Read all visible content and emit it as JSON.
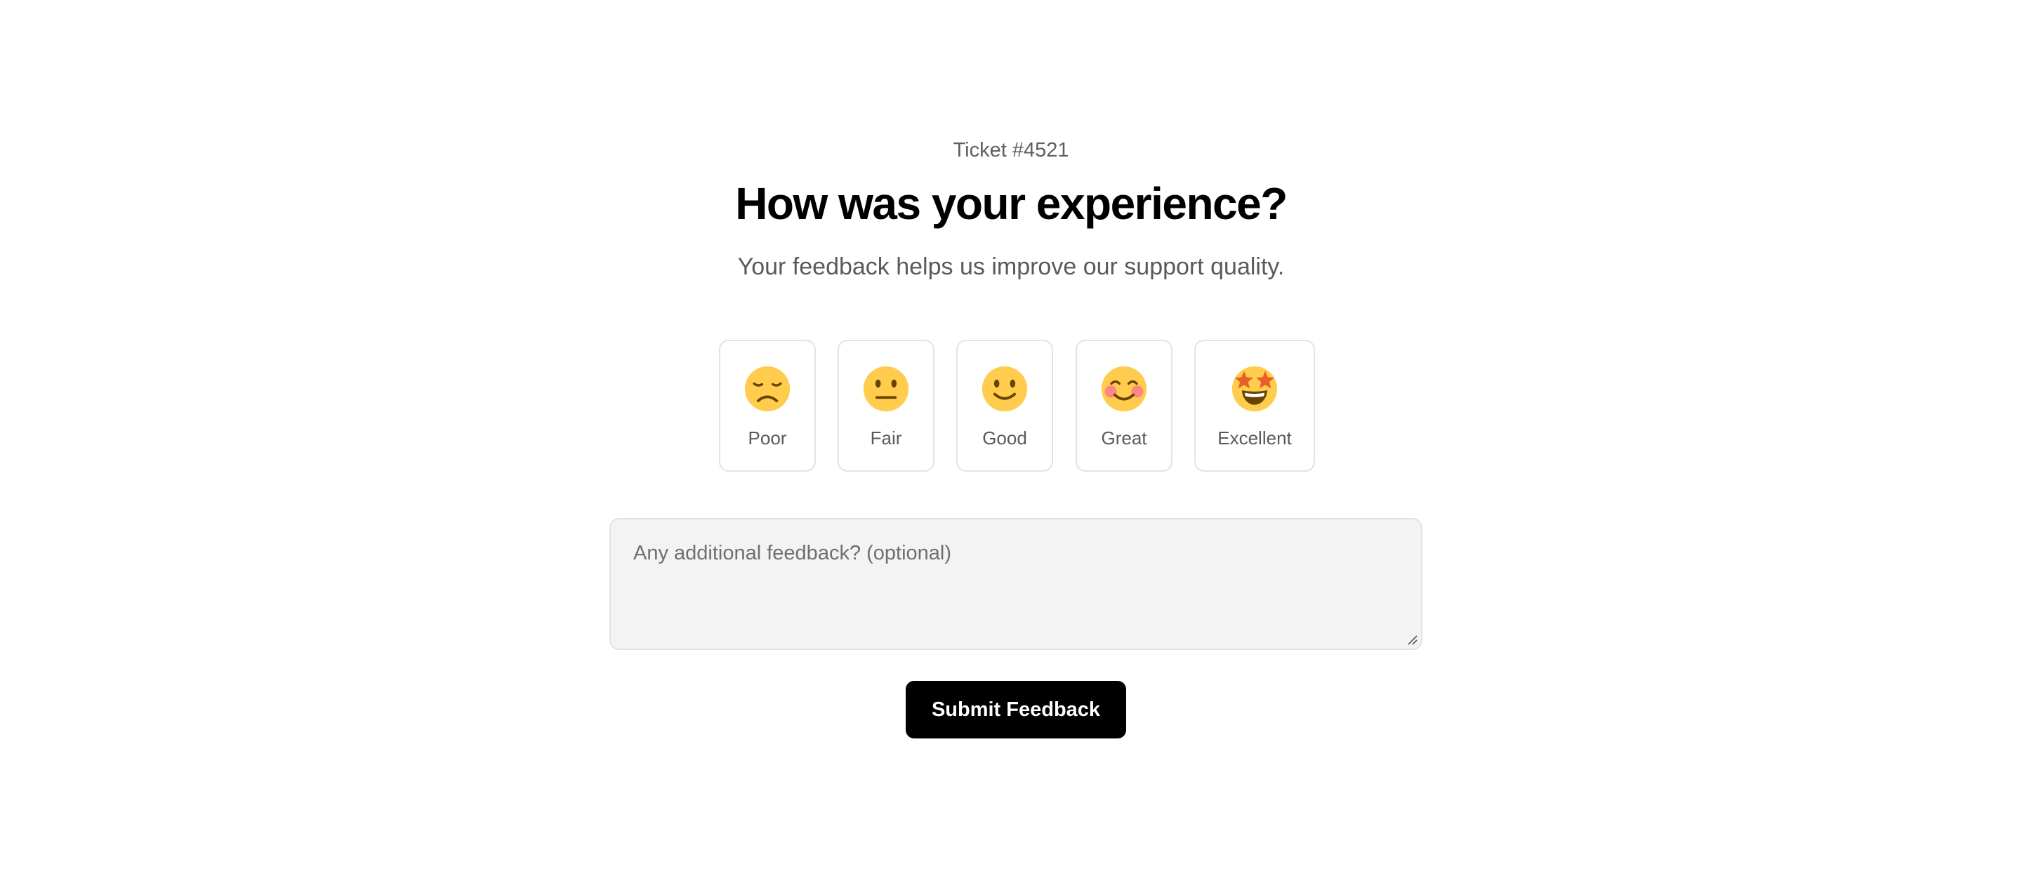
{
  "ticket_label": "Ticket #4521",
  "title": "How was your experience?",
  "subtitle": "Your feedback helps us improve our support quality.",
  "ratings": [
    {
      "label": "Poor",
      "icon": "disappointed-face-icon"
    },
    {
      "label": "Fair",
      "icon": "neutral-face-icon"
    },
    {
      "label": "Good",
      "icon": "slightly-smiling-face-icon"
    },
    {
      "label": "Great",
      "icon": "smiling-blushing-face-icon"
    },
    {
      "label": "Excellent",
      "icon": "star-struck-face-icon"
    }
  ],
  "feedback": {
    "placeholder": "Any additional feedback? (optional)",
    "value": ""
  },
  "submit_label": "Submit Feedback",
  "colors": {
    "face_yellow": "#FFCC4D",
    "face_feature": "#664500",
    "blush": "#FF7892",
    "star": "#E95F28",
    "button_bg": "#000000",
    "button_text": "#FFFFFF"
  }
}
